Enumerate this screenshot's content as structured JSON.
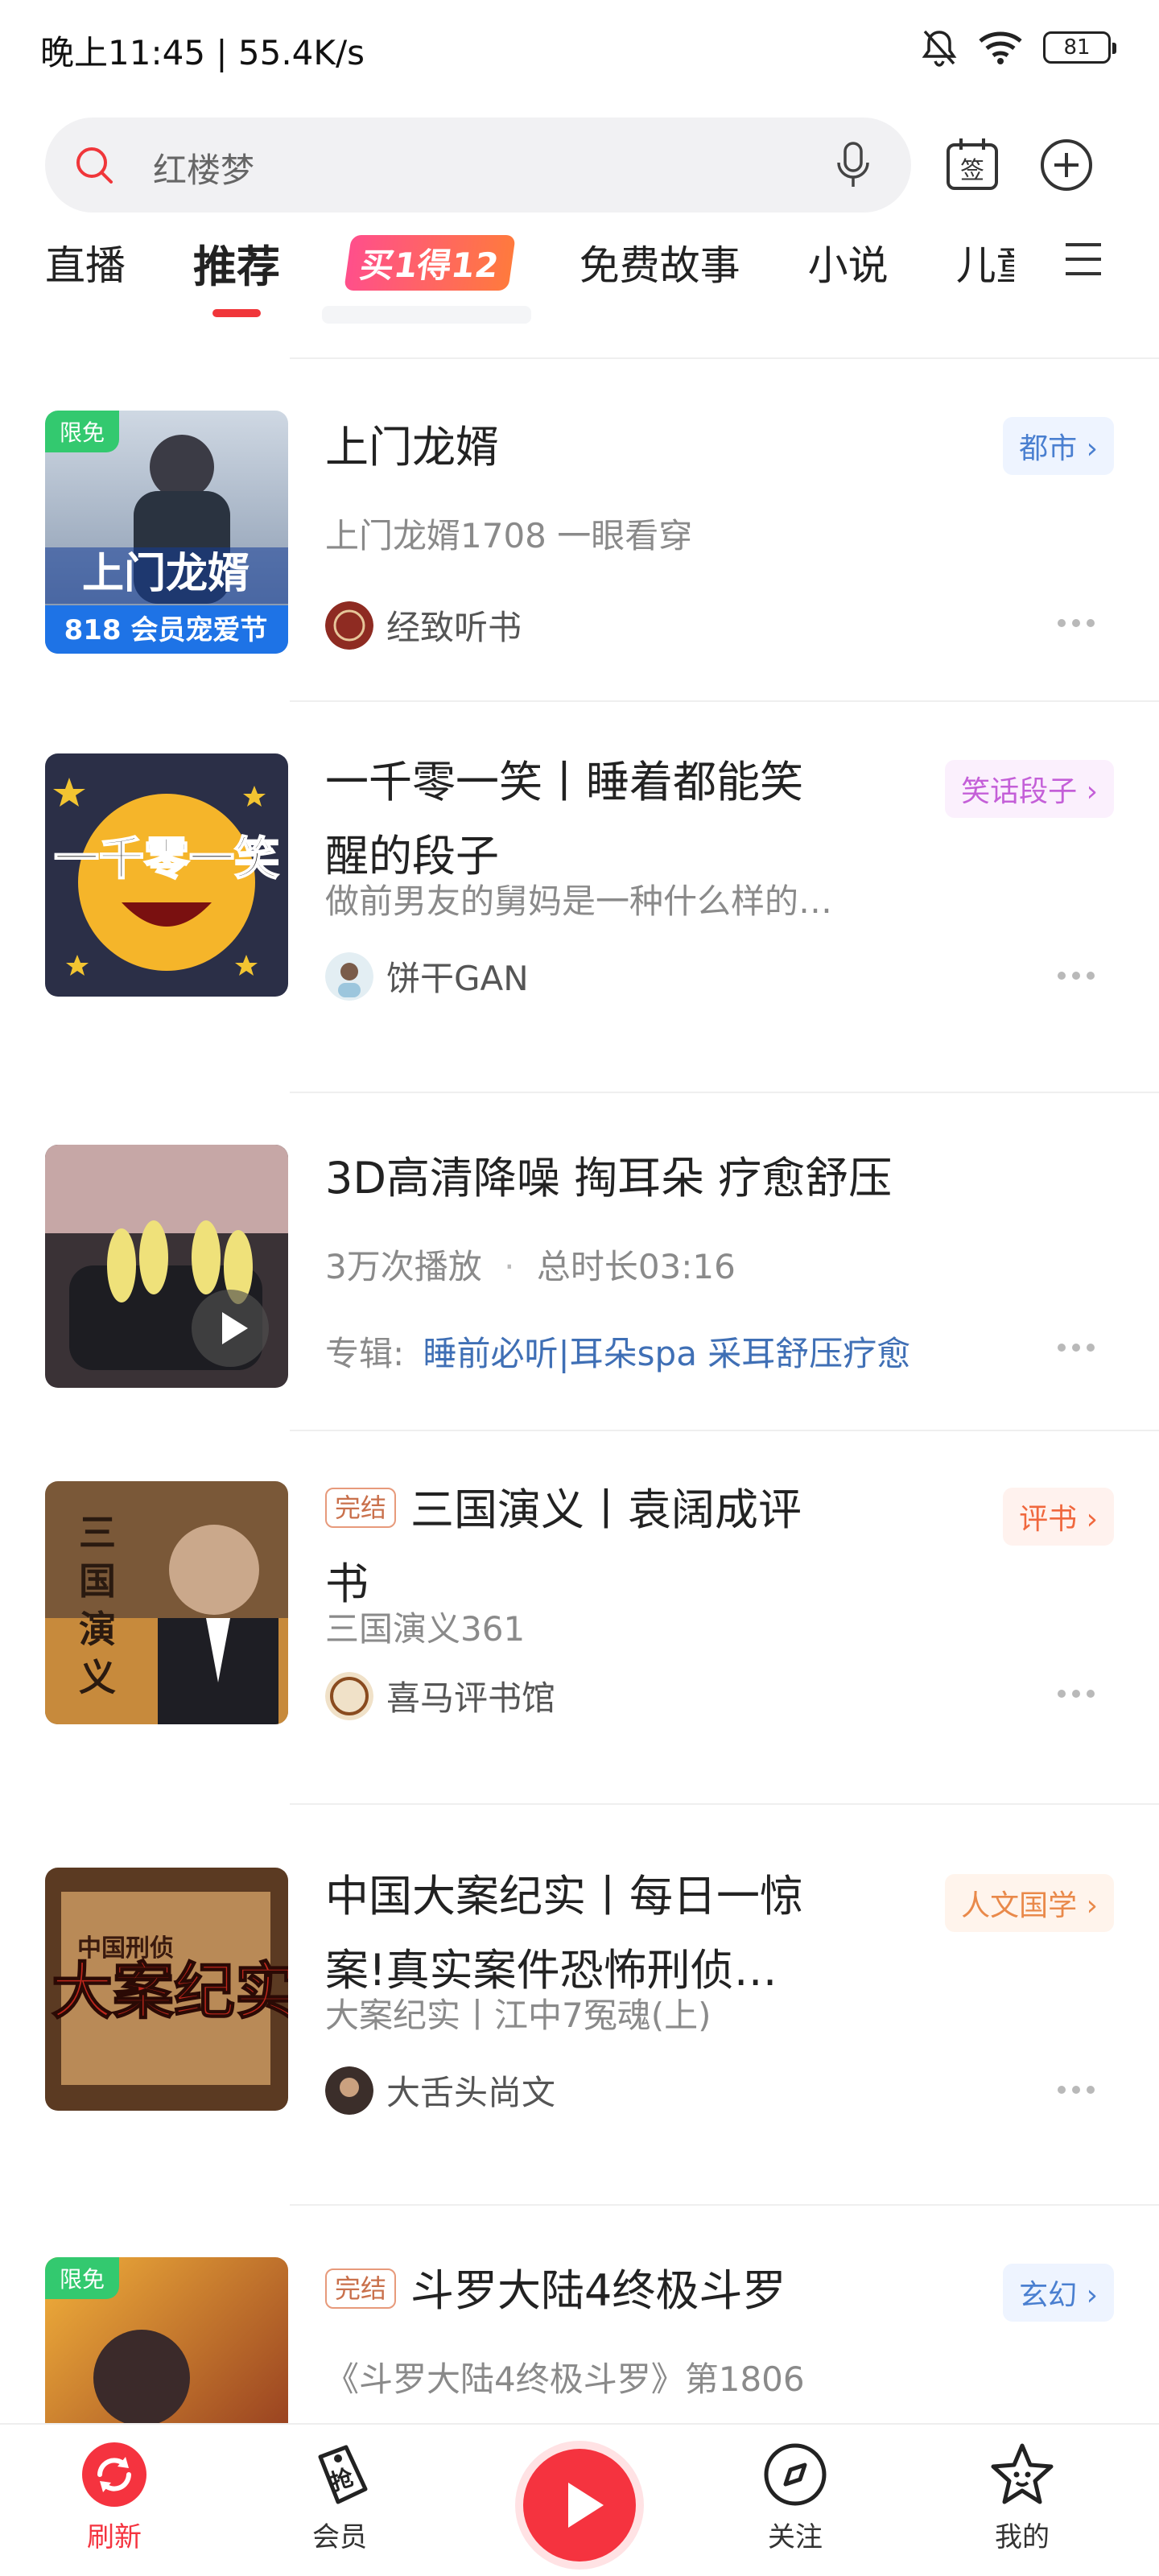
{
  "status_bar": {
    "time_speed": "晚上11:45 | 55.4K/s",
    "battery": "81"
  },
  "search": {
    "placeholder": "红楼梦"
  },
  "tabs": [
    {
      "label": "直播"
    },
    {
      "label": "推荐"
    },
    {
      "label": "买1得12"
    },
    {
      "label": "免费故事"
    },
    {
      "label": "小说"
    },
    {
      "label": "儿童"
    }
  ],
  "items": [
    {
      "title": "上门龙婿",
      "subtitle": "上门龙婿1708 一眼看穿",
      "author": "经致听书",
      "tag": "都市",
      "badge": "限免",
      "cover_text": "上门龙婿",
      "cover_sub": "818 会员宠爱节"
    },
    {
      "title_line1": "一千零一笑丨睡着都能笑",
      "title_line2": "醒的段子",
      "subtitle": "做前男友的舅妈是一种什么样的…",
      "author": "饼干GAN",
      "tag": "笑话段子",
      "cover_text": "一千零一笑"
    },
    {
      "title": "3D高清降噪 掏耳朵 疗愈舒压",
      "plays": "3万次播放",
      "sep": "·",
      "duration": "总时长03:16",
      "album_label": "专辑:",
      "album_name": "睡前必听|耳朵spa 采耳舒压疗愈"
    },
    {
      "done": "完结",
      "title_line1": "三国演义丨袁阔成评",
      "title_line2": "书",
      "subtitle": "三国演义361",
      "author": "喜马评书馆",
      "tag": "评书",
      "cover_text": "三国演义"
    },
    {
      "title_line1": "中国大案纪实丨每日一惊",
      "title_line2": "案!真实案件恐怖刑侦…",
      "subtitle": "大案纪实丨江中7冤魂(上)",
      "author": "大舌头尚文",
      "tag": "人文国学",
      "cover_text": "大案纪实",
      "cover_side": "中国刑侦"
    },
    {
      "done": "完结",
      "title": "斗罗大陆4终极斗罗",
      "subtitle": "《斗罗大陆4终极斗罗》第1806",
      "tag": "玄幻",
      "badge": "限免"
    }
  ],
  "bottom_nav": [
    {
      "label": "刷新",
      "icon": "refresh-icon"
    },
    {
      "label": "会员",
      "icon": "vip-tag-icon"
    },
    {
      "label": "关注",
      "icon": "compass-icon"
    },
    {
      "label": "我的",
      "icon": "star-face-icon"
    }
  ],
  "colors": {
    "accent": "#f0363a",
    "tag_blue": "#4a7fd0",
    "tag_purple": "#c45fd8",
    "tag_orange": "#f0683e",
    "tag_orange2": "#e9894a",
    "free_green": "#33c96f"
  }
}
